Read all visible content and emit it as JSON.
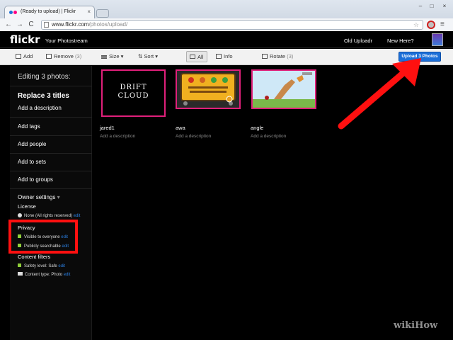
{
  "browser": {
    "tab_title": "(Ready to upload) | Flickr",
    "tab_close": "×",
    "url_host": "www.flickr.com",
    "url_path": "/photos/upload/",
    "back": "←",
    "forward": "→",
    "reload": "C",
    "star": "☆",
    "menu": "≡"
  },
  "site": {
    "logo": "flickr",
    "photostream": "Your Photostream",
    "old_uploadr": "Old Uploadr",
    "new_here": "New Here?"
  },
  "toolbar": {
    "add": "Add",
    "remove": "Remove",
    "remove_count": "(3)",
    "size": "Size ▾",
    "sort": "Sort ▾",
    "all": "All",
    "info": "Info",
    "rotate": "Rotate",
    "rotate_count": "(3)",
    "upload": "Upload 3 Photos"
  },
  "sidebar": {
    "editing": "Editing 3 photos:",
    "replace_titles": "Replace 3 titles",
    "add_description": "Add a description",
    "add_tags": "Add tags",
    "add_people": "Add people",
    "add_to_sets": "Add to sets",
    "add_to_groups": "Add to groups",
    "owner_settings": "Owner settings",
    "license_heading": "License",
    "license_value": "None (All rights reserved)",
    "privacy_heading": "Privacy",
    "privacy_visible": "Visible to everyone",
    "privacy_searchable": "Publicly searchable",
    "content_filters_heading": "Content filters",
    "safety_level": "Safety level: Safe",
    "content_type": "Content type: Photo",
    "edit": "edit"
  },
  "photos": [
    {
      "title": "jared1",
      "description": "Add a description",
      "thumb_text_1": "DRIFT",
      "thumb_text_2": "CLOUD"
    },
    {
      "title": "awa",
      "description": "Add a description"
    },
    {
      "title": "angle",
      "description": "Add a description"
    }
  ],
  "watermark": "wikiHow",
  "colors": {
    "highlight_border": "#e0207a",
    "upload_button": "#1b6fd8",
    "edit_link": "#2b7fe0",
    "callout": "#ff1010"
  },
  "icons": [
    "page-icon",
    "star-icon",
    "wrench-icon",
    "add-icon",
    "remove-icon",
    "size-icon",
    "sort-icon",
    "all-icon",
    "info-icon",
    "rotate-icon",
    "globe-icon",
    "check-icon",
    "camera-icon",
    "arrow-icon"
  ]
}
